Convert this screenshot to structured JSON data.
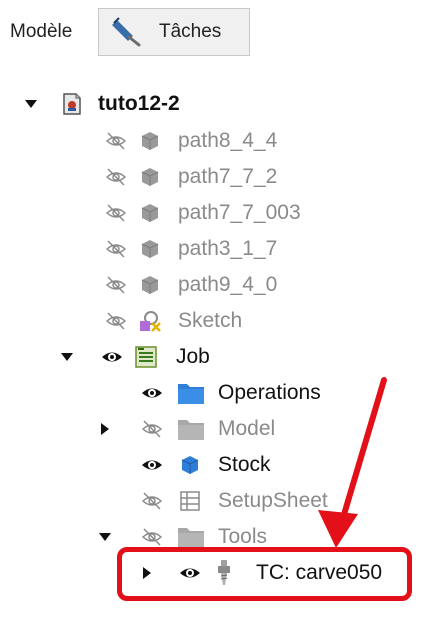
{
  "tabs": [
    {
      "label": "Modèle"
    },
    {
      "label": "Tâches"
    }
  ],
  "tree": {
    "root": {
      "label": "tuto12-2"
    },
    "children": [
      {
        "label": "path8_4_4"
      },
      {
        "label": "path7_7_2"
      },
      {
        "label": "path7_7_003"
      },
      {
        "label": "path3_1_7"
      },
      {
        "label": "path9_4_0"
      },
      {
        "label": "Sketch"
      }
    ],
    "job": {
      "label": "Job",
      "children": [
        {
          "label": "Operations"
        },
        {
          "label": "Model"
        },
        {
          "label": "Stock"
        },
        {
          "label": "SetupSheet"
        },
        {
          "label": "Tools"
        }
      ],
      "tool_controller": {
        "label": "TC: carve050"
      }
    }
  },
  "colors": {
    "highlight": "#e3101a",
    "dim_text": "#8a8a8a",
    "folder_blue": "#2f7fd8",
    "folder_gray": "#b5b5b5"
  }
}
